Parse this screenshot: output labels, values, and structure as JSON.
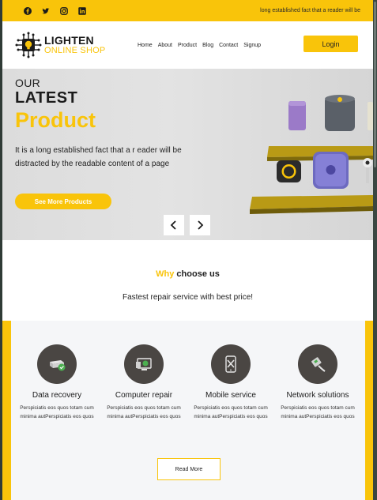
{
  "topbar": {
    "socials": [
      "facebook-icon",
      "twitter-icon",
      "instagram-icon",
      "linkedin-icon"
    ],
    "text": "long established fact that a reader will be"
  },
  "header": {
    "logo_line1": "LIGHTEN",
    "logo_line2": "ONLINE SHOP",
    "nav": [
      "Home",
      "About",
      "Product",
      "Blog",
      "Contact",
      "Signup"
    ],
    "login_label": "Login"
  },
  "hero": {
    "our": "OUR",
    "latest": "LATEST",
    "product": "Product",
    "description": "It is a long established fact that a r eader will be distracted by the readable content of a page",
    "button_label": "See More Products",
    "prev_icon": "chevron-left-icon",
    "next_icon": "chevron-right-icon"
  },
  "why": {
    "accent": "Why",
    "rest": " choose us",
    "subtitle": "Fastest repair service with best price!"
  },
  "services": {
    "items": [
      {
        "title": "Data recovery",
        "desc": "Perspiciatis eos quos totam cum minima autPerspiciatis eos quos",
        "icon": "hard-drive-icon"
      },
      {
        "title": "Computer repair",
        "desc": "Perspiciatis eos quos totam cum minima autPerspiciatis eos quos",
        "icon": "computer-icon"
      },
      {
        "title": "Mobile service",
        "desc": "Perspiciatis eos quos totam cum minima autPerspiciatis eos quos",
        "icon": "mobile-tools-icon"
      },
      {
        "title": "Network solutions",
        "desc": "Perspiciatis eos quos totam cum minima autPerspiciatis eos quos",
        "icon": "network-cable-icon"
      }
    ],
    "read_more_label": "Read More"
  },
  "colors": {
    "accent": "#f9c40a",
    "icon_circle": "#4a4643",
    "service_bg": "#f5f6f8"
  }
}
